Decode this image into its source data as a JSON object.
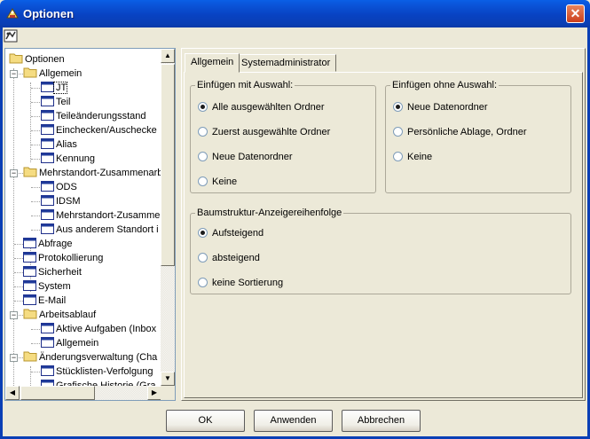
{
  "window": {
    "title": "Optionen",
    "close_glyph": "✕"
  },
  "icons": {
    "app": "app-icon",
    "toolbar": "toolbar-tool-icon"
  },
  "tree": [
    {
      "label": "Optionen",
      "level": 0,
      "icon": "folder"
    },
    {
      "label": "Allgemein",
      "level": 1,
      "icon": "folder",
      "expanded": true
    },
    {
      "label": "JT",
      "level": 2,
      "icon": "page",
      "selected": true
    },
    {
      "label": "Teil",
      "level": 2,
      "icon": "page"
    },
    {
      "label": "Teileänderungsstand",
      "level": 2,
      "icon": "page"
    },
    {
      "label": "Einchecken/Auschecke",
      "level": 2,
      "icon": "page"
    },
    {
      "label": "Alias",
      "level": 2,
      "icon": "page"
    },
    {
      "label": "Kennung",
      "level": 2,
      "icon": "page"
    },
    {
      "label": "Mehrstandort-Zusammenarb",
      "level": 1,
      "icon": "folder",
      "expanded": true
    },
    {
      "label": "ODS",
      "level": 2,
      "icon": "page"
    },
    {
      "label": "IDSM",
      "level": 2,
      "icon": "page"
    },
    {
      "label": "Mehrstandort-Zusamme",
      "level": 2,
      "icon": "page"
    },
    {
      "label": "Aus anderem Standort i",
      "level": 2,
      "icon": "page"
    },
    {
      "label": "Abfrage",
      "level": 1,
      "icon": "page"
    },
    {
      "label": "Protokollierung",
      "level": 1,
      "icon": "page"
    },
    {
      "label": "Sicherheit",
      "level": 1,
      "icon": "page"
    },
    {
      "label": "System",
      "level": 1,
      "icon": "page"
    },
    {
      "label": "E-Mail",
      "level": 1,
      "icon": "page"
    },
    {
      "label": "Arbeitsablauf",
      "level": 1,
      "icon": "folder",
      "expanded": true
    },
    {
      "label": "Aktive Aufgaben (Inbox",
      "level": 2,
      "icon": "page"
    },
    {
      "label": "Allgemein",
      "level": 2,
      "icon": "page"
    },
    {
      "label": "Änderungsverwaltung (Cha",
      "level": 1,
      "icon": "folder",
      "expanded": true
    },
    {
      "label": "Stücklisten-Verfolgung",
      "level": 2,
      "icon": "page"
    },
    {
      "label": "Grafische Historie (Gra",
      "level": 2,
      "icon": "page"
    }
  ],
  "tabs": [
    {
      "label": "Allgemein",
      "active": true
    },
    {
      "label": "Systemadministrator",
      "active": false
    }
  ],
  "groups": {
    "with_selection": {
      "title": "Einfügen mit Auswahl:",
      "options": [
        {
          "label": "Alle ausgewählten Ordner",
          "checked": true
        },
        {
          "label": "Zuerst ausgewählte Ordner",
          "checked": false
        },
        {
          "label": "Neue Datenordner",
          "checked": false
        },
        {
          "label": "Keine",
          "checked": false
        }
      ]
    },
    "without_selection": {
      "title": "Einfügen ohne Auswahl:",
      "options": [
        {
          "label": "Neue Datenordner",
          "checked": true
        },
        {
          "label": "Persönliche Ablage, Ordner",
          "checked": false
        },
        {
          "label": "Keine",
          "checked": false
        }
      ]
    },
    "tree_order": {
      "title": "Baumstruktur-Anzeigereihenfolge",
      "options": [
        {
          "label": "Aufsteigend",
          "checked": true
        },
        {
          "label": "absteigend",
          "checked": false
        },
        {
          "label": "keine Sortierung",
          "checked": false
        }
      ]
    }
  },
  "buttons": {
    "ok": "OK",
    "apply": "Anwenden",
    "cancel": "Abbrechen"
  }
}
